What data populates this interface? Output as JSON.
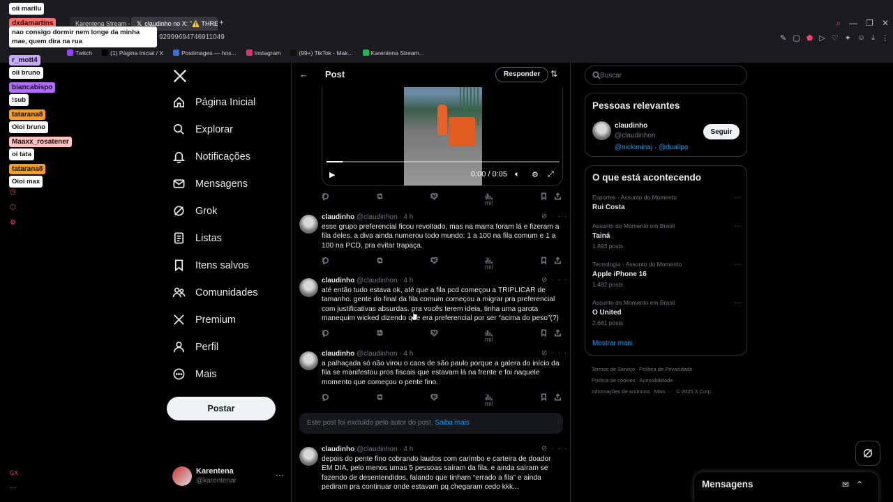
{
  "browser": {
    "tabs": [
      {
        "label": "Karentena Stream - Watch"
      },
      {
        "label": "claudinho no X: \"⚠️ THRE"
      }
    ],
    "url_fragment": "9299969474691104​9",
    "bookmarks": [
      {
        "label": "Twitch",
        "color": "#9146ff"
      },
      {
        "label": "(1) Página Inicial / X",
        "color": "#000000"
      },
      {
        "label": "Postimages — hos...",
        "color": "#3b6fd8"
      },
      {
        "label": "Instagram",
        "color": "#e1306c"
      },
      {
        "label": "(99+) TikTok - Mak...",
        "color": "#111111"
      },
      {
        "label": "Karentena Stream...",
        "color": "#1db954"
      }
    ]
  },
  "chat": [
    {
      "type": "msg",
      "text": "oii marilu"
    },
    {
      "type": "user",
      "text": "dxdamartins",
      "color": "#ff6b6b"
    },
    {
      "type": "msg",
      "text": "nao consigo dormir nem longe da minha mae, quem dira na rua"
    },
    {
      "type": "user",
      "text": "r_mott4",
      "color": "#c9a8ff"
    },
    {
      "type": "msg",
      "text": "oii bruno"
    },
    {
      "type": "user",
      "text": "biancabispo",
      "color": "#b36bff"
    },
    {
      "type": "msg",
      "text": "!sub"
    },
    {
      "type": "user",
      "text": "tatarana8",
      "color": "#ff9c1a"
    },
    {
      "type": "msg",
      "text": "Oioi bruno"
    },
    {
      "type": "user",
      "text": "Maaxx_rosatener",
      "color": "#ffc2c2"
    },
    {
      "type": "msg",
      "text": "oi tata"
    },
    {
      "type": "user",
      "text": "tatarana8",
      "color": "#ff9c1a"
    },
    {
      "type": "msg",
      "text": "Oioi max"
    }
  ],
  "nav": {
    "items": [
      {
        "label": "Página Inicial",
        "icon": "home-icon"
      },
      {
        "label": "Explorar",
        "icon": "search-icon"
      },
      {
        "label": "Notificações",
        "icon": "bell-icon"
      },
      {
        "label": "Mensagens",
        "icon": "mail-icon"
      },
      {
        "label": "Grok",
        "icon": "grok-icon"
      },
      {
        "label": "Listas",
        "icon": "list-icon"
      },
      {
        "label": "Itens salvos",
        "icon": "bookmark-icon"
      },
      {
        "label": "Comunidades",
        "icon": "people-icon"
      },
      {
        "label": "Premium",
        "icon": "x-icon"
      },
      {
        "label": "Perfil",
        "icon": "person-icon"
      },
      {
        "label": "Mais",
        "icon": "more-circle-icon"
      }
    ],
    "post_button": "Postar",
    "account": {
      "name": "Karentena",
      "handle": "@karentenar"
    }
  },
  "main": {
    "title": "Post",
    "reply_button": "Responder",
    "video": {
      "time": "0:00 / 0:05",
      "progress": 0.07
    },
    "first_actions": {
      "replies": "2",
      "retweets": "",
      "likes": "28",
      "views": "4 mil"
    },
    "tweets": [
      {
        "name": "claudinho",
        "handle": "@claudinhon",
        "time": "· 4 h",
        "text": "esse grupo preferencial ficou revoltado, mas na marra foram lá e fizeram a fila deles. a diva ainda numerou todo mundo: 1 a 100 na fila comum e 1 a 100 na PCD, pra evitar trapaça.",
        "replies": "2",
        "retweets": "",
        "likes": "23",
        "views": "2 mil"
      },
      {
        "name": "claudinho",
        "handle": "@claudinhon",
        "time": "· 4 h",
        "text": "até então tudo estava ok, até que a fila pcd começou a TRIPLICAR de tamanho. gente do final da fila comum começou a migrar pra preferencial com justificativas absurdas. pra vocês terem ideia, tinha uma garota manequim wicked dizendo que era preferencial por ser “acima do peso”(?)",
        "replies": "3",
        "retweets": "16",
        "likes": "59",
        "views": "4 mil"
      },
      {
        "name": "claudinho",
        "handle": "@claudinhon",
        "time": "· 4 h",
        "text": "a palhaçada só não virou o caos de são paulo porque a galera do início da fila se manifestou pros fiscais que estavam lá na frente e foi naquele momento que começou o pente fino.",
        "replies": "1",
        "retweets": "",
        "likes": "18",
        "views": "2 mil"
      },
      {
        "name": "claudinho",
        "handle": "@claudinhon",
        "time": "· 4 h",
        "text": "depois do pente fino cobrando laudos com carimbo e carteira de doador EM DIA, pelo menos umas 5 pessoas saíram da fila. e ainda saíram se fazendo de desentendidos, falando que tinham “errado a fila” e ainda pediram pra continuar onde estavam pq chegaram cedo kkk..."
      }
    ],
    "deleted_notice": "Este post foi excluído pelo autor do post.",
    "deleted_link": "Saiba mais"
  },
  "right": {
    "search_placeholder": "Buscar",
    "relevant": {
      "title": "Pessoas relevantes",
      "name": "claudinho",
      "handle": "@claudinhon",
      "links": "@nickiminaj · @dualipa",
      "follow": "Seguir"
    },
    "trends": {
      "title": "O que está acontecendo",
      "items": [
        {
          "category": "Esportes · Assunto do Momento",
          "title": "Rui Costa",
          "count": ""
        },
        {
          "category": "Assunto do Momento em Brasil",
          "title": "Tainá",
          "count": "1.893 posts"
        },
        {
          "category": "Tecnologia · Assunto do Momento",
          "title": "Apple iPhone 16",
          "count": "1.482 posts"
        },
        {
          "category": "Assunto do Momento em Brasil",
          "title": "O United",
          "count": "2.681 posts"
        }
      ],
      "show_more": "Mostrar mais"
    },
    "footer": [
      "Termos de Serviço",
      "Política de Privacidade",
      "Política de cookies",
      "Acessibilidade",
      "Informações de anúncios",
      "Mais ···",
      "© 2025 X Corp."
    ]
  },
  "messages_dock": {
    "title": "Mensagens"
  }
}
